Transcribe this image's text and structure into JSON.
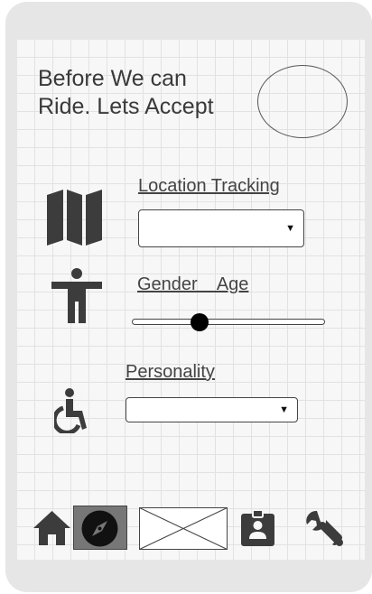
{
  "header": {
    "title": "Before We can Ride. Lets Accept"
  },
  "sections": {
    "location": {
      "label": "Location Tracking",
      "selected_value": "",
      "icon": "map-icon"
    },
    "gender_age": {
      "label": "Gender    Age",
      "slider_value": 0.35,
      "icon": "person-icon"
    },
    "personality": {
      "label": "Personality",
      "selected_value": "",
      "icon": "accessibility-icon"
    }
  },
  "bottom_nav": {
    "items": [
      "home-icon",
      "compass-icon",
      "image-placeholder",
      "contact-badge-icon",
      "wrench-icon"
    ],
    "selected": "compass-icon"
  },
  "colors": {
    "icon": "#3c3c3c",
    "frame": "#e6e6e6",
    "selected_nav": "#777777"
  }
}
